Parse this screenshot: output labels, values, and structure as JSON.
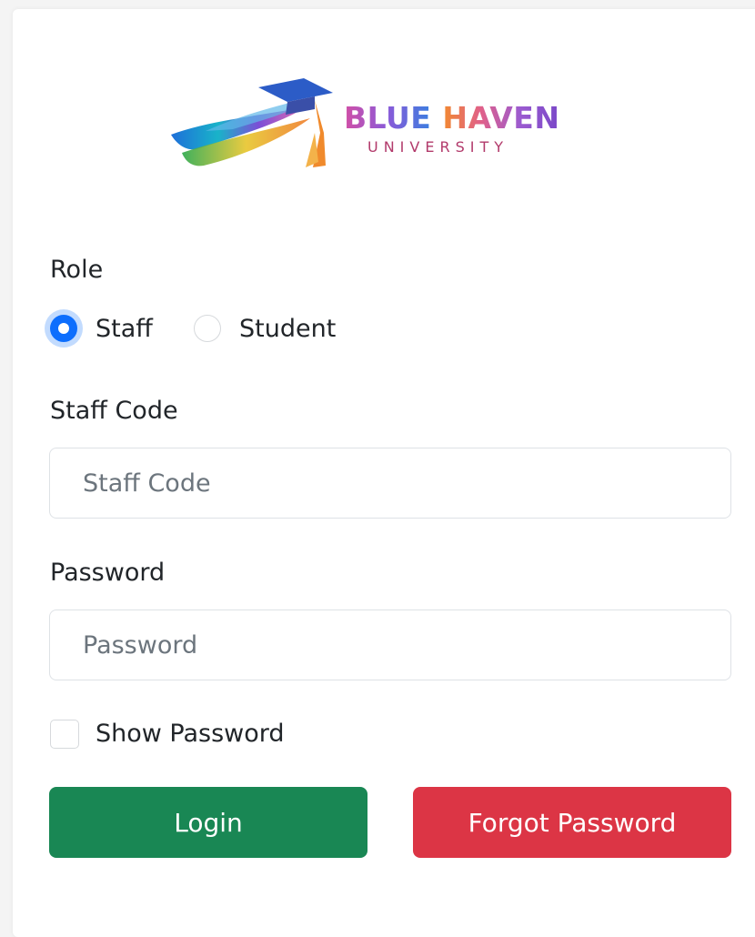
{
  "logo": {
    "title_part1": "BLUE",
    "title_part2": "HAVEN",
    "subtitle": "UNIVERSITY"
  },
  "form": {
    "role_label": "Role",
    "role_options": [
      "Staff",
      "Student"
    ],
    "role_selected": "Staff",
    "staff_code_label": "Staff Code",
    "staff_code_placeholder": "Staff Code",
    "password_label": "Password",
    "password_placeholder": "Password",
    "show_password_label": "Show Password",
    "login_button": "Login",
    "forgot_button": "Forgot Password"
  },
  "colors": {
    "primary": "#0d6efd",
    "success": "#198754",
    "danger": "#dc3545"
  }
}
